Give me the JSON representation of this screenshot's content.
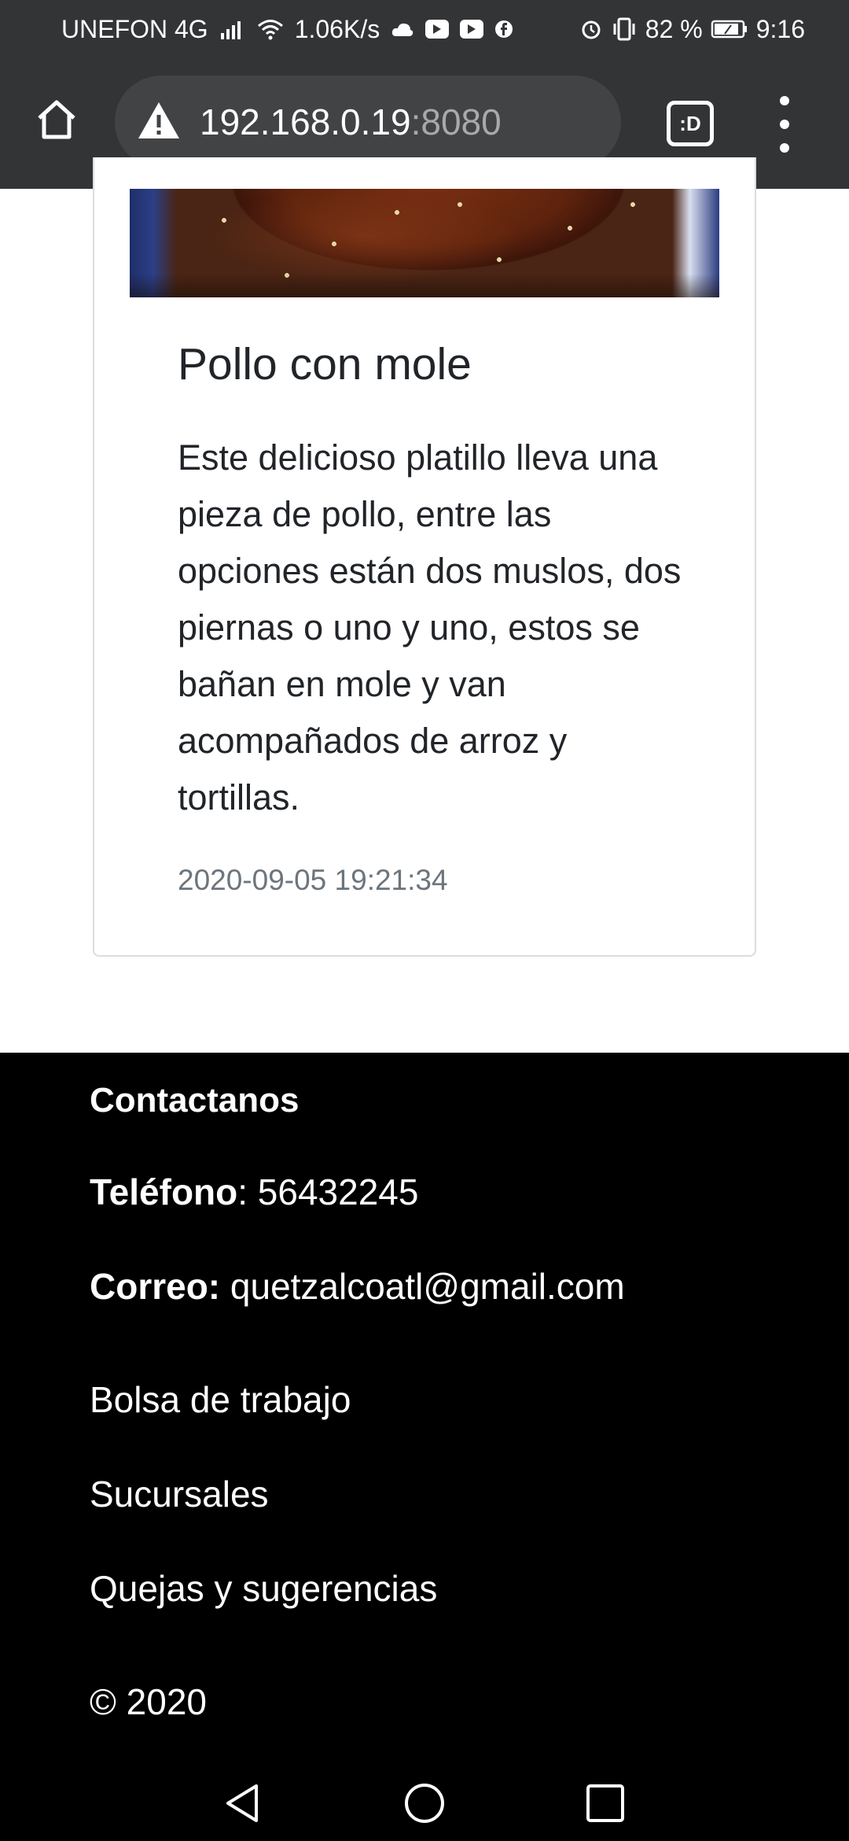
{
  "status_bar": {
    "carrier": "UNEFON 4G",
    "speed": "1.06K/s",
    "battery": "82 %",
    "time": "9:16"
  },
  "browser": {
    "url_host": "192.168.0.19",
    "url_port": ":8080",
    "tab_label": ":D"
  },
  "card": {
    "title": "Pollo con mole",
    "description": "Este delicioso platillo lleva una pieza de pollo, entre las opciones están dos muslos, dos piernas o uno y uno, estos se bañan en mole y van acompañados de arroz y tortillas.",
    "date": "2020-09-05 19:21:34"
  },
  "footer": {
    "heading": "Contactanos",
    "phone_label": "Teléfono",
    "phone_value": ": 56432245",
    "email_label": "Correo:",
    "email_value": " quetzalcoatl@gmail.com",
    "links": [
      "Bolsa de trabajo",
      "Sucursales",
      "Quejas y sugerencias"
    ],
    "copyright": "© 2020"
  },
  "colors": {
    "toolbar_bg": "#333436",
    "footer_bg": "#000000",
    "date_gray": "#6c757d"
  }
}
